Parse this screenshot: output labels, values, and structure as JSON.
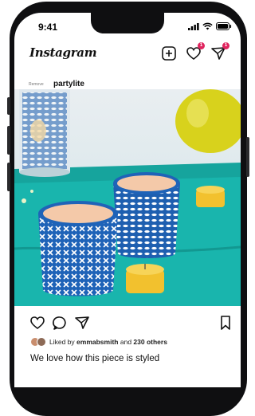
{
  "status": {
    "time": "9:41"
  },
  "app": {
    "name": "Instagram"
  },
  "header_icons": {
    "new_post": "plus-square-icon",
    "activity": "heart-icon",
    "direct": "paper-plane-icon",
    "activity_badge": "1",
    "direct_badge": "1"
  },
  "post": {
    "small_label": "Remove",
    "username": "partylite",
    "liked_prefix": "Liked by",
    "liked_user": "emmabsmith",
    "liked_and": "and",
    "liked_count": "230 others",
    "caption": "We love how this piece is styled"
  },
  "colors": {
    "table": "#19b5ad",
    "cup_blue": "#1f63b8",
    "tealight": "#f2c12e",
    "vase": "#d8d21c",
    "badge": "#e0245e"
  }
}
